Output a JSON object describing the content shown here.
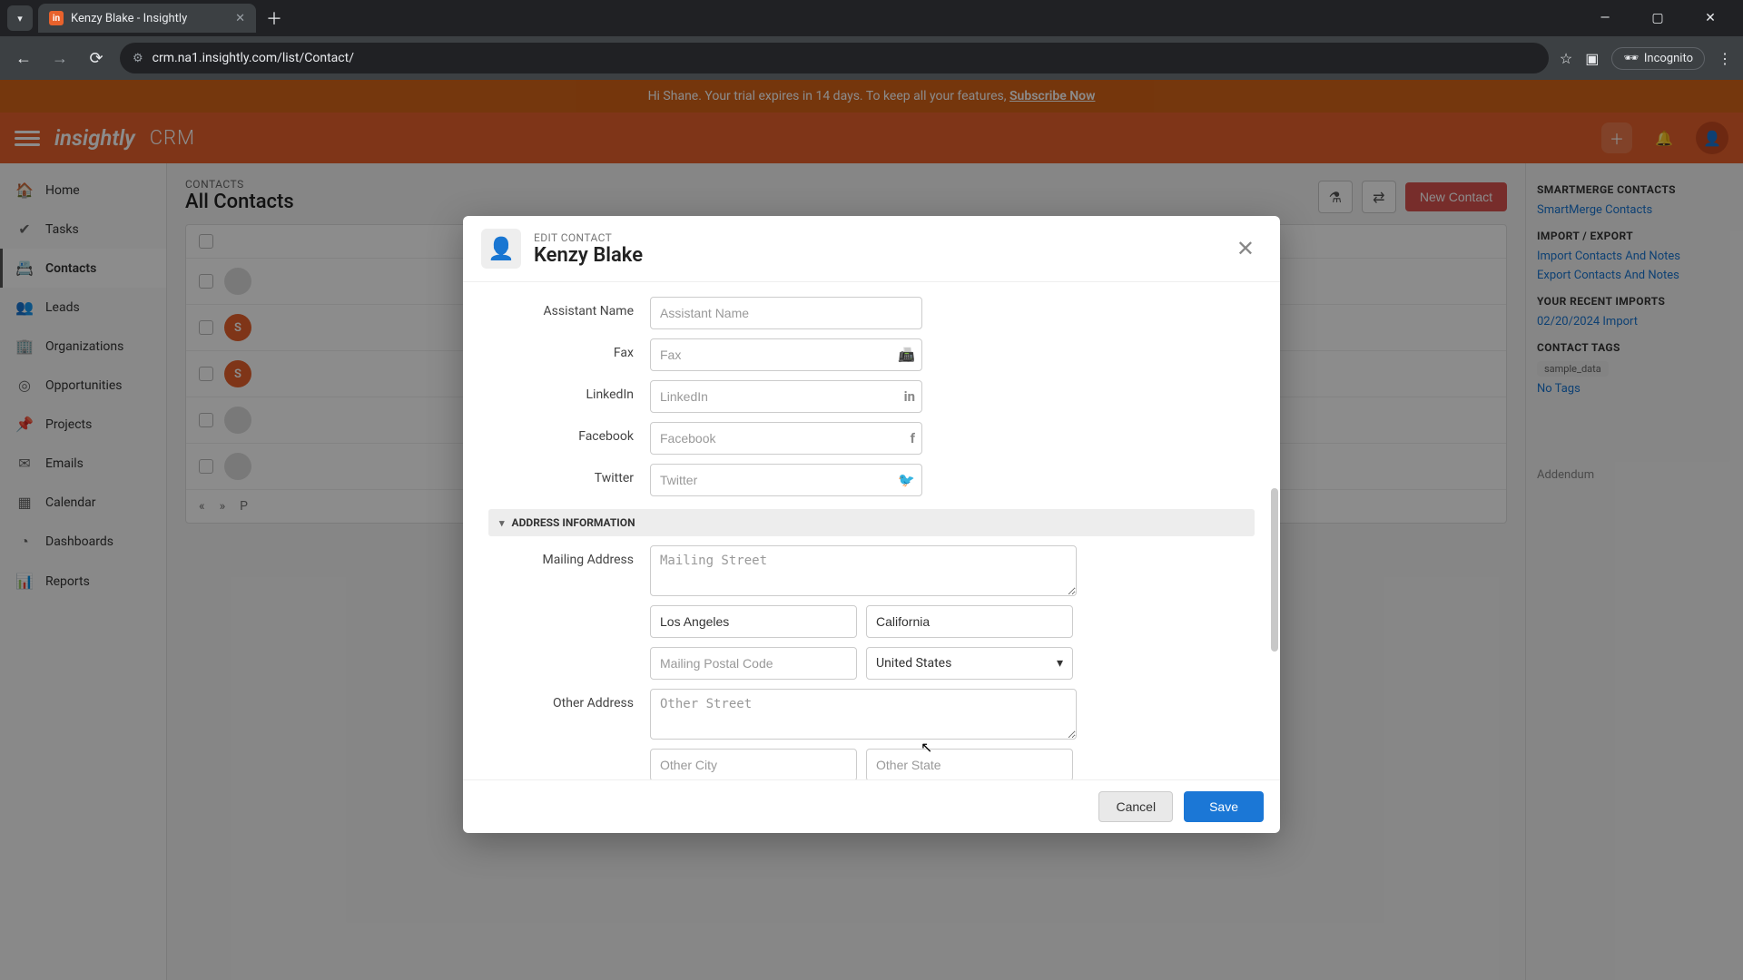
{
  "browser": {
    "tab_title": "Kenzy Blake - Insightly",
    "url": "crm.na1.insightly.com/list/Contact/",
    "incognito_label": "Incognito"
  },
  "trial_banner": {
    "text_prefix": "Hi Shane. Your trial expires in 14 days. To keep all your features, ",
    "cta": "Subscribe Now"
  },
  "header": {
    "brand": "insightly",
    "app": "CRM"
  },
  "sidebar": {
    "items": [
      {
        "label": "Home",
        "icon": "⌂"
      },
      {
        "label": "Tasks",
        "icon": "✔"
      },
      {
        "label": "Contacts",
        "icon": "▭"
      },
      {
        "label": "Leads",
        "icon": "👥"
      },
      {
        "label": "Organizations",
        "icon": "🏢"
      },
      {
        "label": "Opportunities",
        "icon": "◎"
      },
      {
        "label": "Projects",
        "icon": "📌"
      },
      {
        "label": "Emails",
        "icon": "✉"
      },
      {
        "label": "Calendar",
        "icon": "▦"
      },
      {
        "label": "Dashboards",
        "icon": "◔"
      },
      {
        "label": "Reports",
        "icon": "▞"
      }
    ],
    "active_index": 2
  },
  "list": {
    "eyebrow": "CONTACTS",
    "title": "All Contacts",
    "new_button": "New Contact",
    "page_label_fragment": "P",
    "rows_avatar_letters": [
      "",
      "",
      "S",
      "S",
      "",
      ""
    ]
  },
  "right_panel": {
    "h1": "SMARTMERGE CONTACTS",
    "l1": "SmartMerge Contacts",
    "h2": "IMPORT / EXPORT",
    "l2": "Import Contacts And Notes",
    "l3": "Export Contacts And Notes",
    "h3": "YOUR RECENT IMPORTS",
    "l4": "02/20/2024 Import",
    "h4": "CONTACT TAGS",
    "tag": "sample_data",
    "l5": "No Tags",
    "addendum": "Addendum"
  },
  "modal": {
    "subtitle": "EDIT CONTACT",
    "title": "Kenzy Blake",
    "section_address": "ADDRESS INFORMATION",
    "labels": {
      "assistant": "Assistant Name",
      "fax": "Fax",
      "linkedin": "LinkedIn",
      "facebook": "Facebook",
      "twitter": "Twitter",
      "mailing": "Mailing Address",
      "other": "Other Address"
    },
    "placeholders": {
      "assistant": "Assistant Name",
      "fax": "Fax",
      "linkedin": "LinkedIn",
      "facebook": "Facebook",
      "twitter": "Twitter",
      "mailing_street": "Mailing Street",
      "mailing_postal": "Mailing Postal Code",
      "other_street": "Other Street",
      "other_city": "Other City",
      "other_state": "Other State"
    },
    "values": {
      "mailing_city": "Los Angeles",
      "mailing_state": "California",
      "mailing_country": "United States"
    },
    "buttons": {
      "cancel": "Cancel",
      "save": "Save"
    }
  }
}
